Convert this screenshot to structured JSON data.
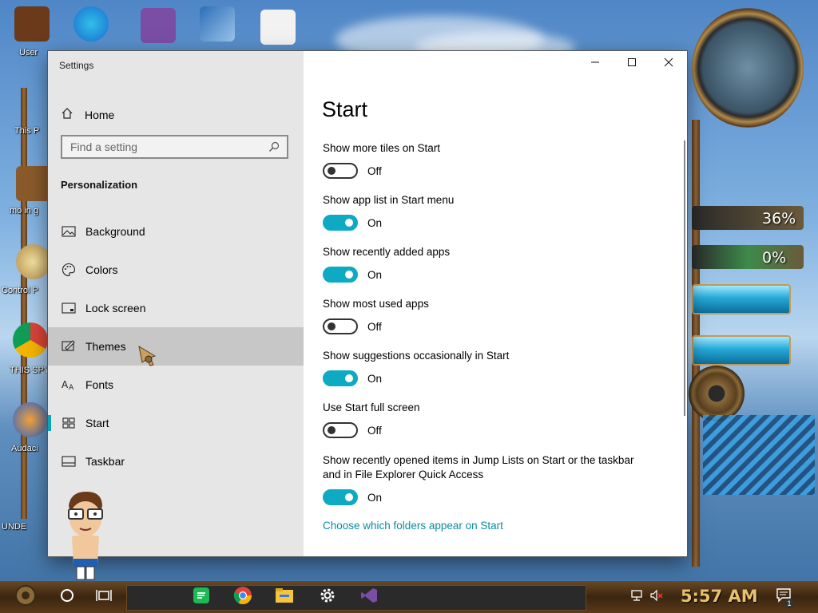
{
  "desktop": {
    "icon_labels": [
      "User",
      "This P",
      "mo in g",
      "Control P",
      "THIS SPYWA",
      "Audaci",
      "UNDE"
    ],
    "gauges": [
      {
        "text": "36%",
        "value": 36
      },
      {
        "text": "0%",
        "value": 0
      }
    ]
  },
  "window": {
    "title": "Settings",
    "controls": {
      "minimize": "minimize",
      "maximize": "maximize",
      "close": "close"
    }
  },
  "sidebar": {
    "home_label": "Home",
    "search_placeholder": "Find a setting",
    "section_title": "Personalization",
    "items": [
      {
        "label": "Background",
        "icon": "image-icon"
      },
      {
        "label": "Colors",
        "icon": "palette-icon"
      },
      {
        "label": "Lock screen",
        "icon": "lock-screen-icon"
      },
      {
        "label": "Themes",
        "icon": "themes-brush-icon"
      },
      {
        "label": "Fonts",
        "icon": "fonts-icon"
      },
      {
        "label": "Start",
        "icon": "start-tiles-icon"
      },
      {
        "label": "Taskbar",
        "icon": "taskbar-icon"
      }
    ]
  },
  "main": {
    "title": "Start",
    "settings": [
      {
        "label": "Show more tiles on Start",
        "state": "Off"
      },
      {
        "label": "Show app list in Start menu",
        "state": "On"
      },
      {
        "label": "Show recently added apps",
        "state": "On"
      },
      {
        "label": "Show most used apps",
        "state": "Off"
      },
      {
        "label": "Show suggestions occasionally in Start",
        "state": "On"
      },
      {
        "label": "Use Start full screen",
        "state": "Off"
      },
      {
        "label": "Show recently opened items in Jump Lists on Start or the taskbar and in File Explorer Quick Access",
        "state": "On"
      }
    ],
    "link": "Choose which folders appear on Start"
  },
  "taskbar": {
    "time": "5:57 AM",
    "apps": [
      "spotify-icon",
      "chrome-icon",
      "file-explorer-icon",
      "settings-gear-icon",
      "visual-studio-icon"
    ],
    "notification_count": "1"
  },
  "colors": {
    "accent": "#0eaac3",
    "link": "#0b8ba3",
    "sidebar_bg": "#e6e6e6",
    "hover_bg": "#c7c7c7"
  }
}
